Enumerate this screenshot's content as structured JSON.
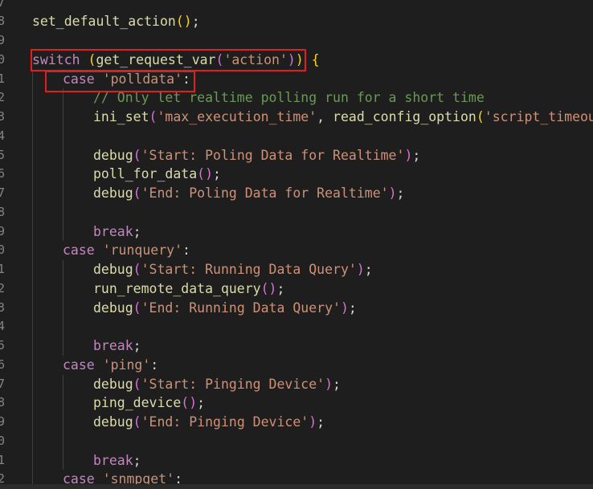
{
  "editor": {
    "lines": [
      {
        "ln": "7",
        "indent": 0,
        "tokens": []
      },
      {
        "ln": "8",
        "indent": 0,
        "tokens": [
          {
            "t": "set_default_action",
            "c": "fn"
          },
          {
            "t": "()",
            "c": "br1"
          },
          {
            "t": ";",
            "c": "plain"
          }
        ]
      },
      {
        "ln": "9",
        "indent": 0,
        "tokens": []
      },
      {
        "ln": "0",
        "indent": 0,
        "tokens": [
          {
            "t": "switch",
            "c": "kw"
          },
          {
            "t": " ",
            "c": "plain"
          },
          {
            "t": "(",
            "c": "br1"
          },
          {
            "t": "get_request_var",
            "c": "fn"
          },
          {
            "t": "(",
            "c": "br2"
          },
          {
            "t": "'action'",
            "c": "str"
          },
          {
            "t": ")",
            "c": "br2"
          },
          {
            "t": ")",
            "c": "br1"
          },
          {
            "t": " ",
            "c": "plain"
          },
          {
            "t": "{",
            "c": "br1"
          }
        ]
      },
      {
        "ln": "1",
        "indent": 1,
        "tokens": [
          {
            "t": "case",
            "c": "kw"
          },
          {
            "t": " ",
            "c": "plain"
          },
          {
            "t": "'polldata'",
            "c": "str"
          },
          {
            "t": ":",
            "c": "plain"
          }
        ]
      },
      {
        "ln": "2",
        "indent": 2,
        "tokens": [
          {
            "t": "// Only let realtime polling run for a short time",
            "c": "com"
          }
        ]
      },
      {
        "ln": "3",
        "indent": 2,
        "tokens": [
          {
            "t": "ini_set",
            "c": "fn"
          },
          {
            "t": "(",
            "c": "br2"
          },
          {
            "t": "'max_execution_time'",
            "c": "str"
          },
          {
            "t": ", ",
            "c": "plain"
          },
          {
            "t": "read_config_option",
            "c": "fn"
          },
          {
            "t": "(",
            "c": "br1"
          },
          {
            "t": "'script_timeout'",
            "c": "str"
          }
        ]
      },
      {
        "ln": "4",
        "indent": 0,
        "tokens": []
      },
      {
        "ln": "5",
        "indent": 2,
        "tokens": [
          {
            "t": "debug",
            "c": "fn"
          },
          {
            "t": "(",
            "c": "br2"
          },
          {
            "t": "'Start: Poling Data for Realtime'",
            "c": "str"
          },
          {
            "t": ")",
            "c": "br2"
          },
          {
            "t": ";",
            "c": "plain"
          }
        ]
      },
      {
        "ln": "6",
        "indent": 2,
        "tokens": [
          {
            "t": "poll_for_data",
            "c": "fn"
          },
          {
            "t": "()",
            "c": "br2"
          },
          {
            "t": ";",
            "c": "plain"
          }
        ]
      },
      {
        "ln": "7",
        "indent": 2,
        "tokens": [
          {
            "t": "debug",
            "c": "fn"
          },
          {
            "t": "(",
            "c": "br2"
          },
          {
            "t": "'End: Poling Data for Realtime'",
            "c": "str"
          },
          {
            "t": ")",
            "c": "br2"
          },
          {
            "t": ";",
            "c": "plain"
          }
        ]
      },
      {
        "ln": "8",
        "indent": 0,
        "tokens": []
      },
      {
        "ln": "9",
        "indent": 2,
        "tokens": [
          {
            "t": "break",
            "c": "kw"
          },
          {
            "t": ";",
            "c": "plain"
          }
        ]
      },
      {
        "ln": "0",
        "indent": 1,
        "tokens": [
          {
            "t": "case",
            "c": "kw"
          },
          {
            "t": " ",
            "c": "plain"
          },
          {
            "t": "'runquery'",
            "c": "str"
          },
          {
            "t": ":",
            "c": "plain"
          }
        ]
      },
      {
        "ln": "1",
        "indent": 2,
        "tokens": [
          {
            "t": "debug",
            "c": "fn"
          },
          {
            "t": "(",
            "c": "br2"
          },
          {
            "t": "'Start: Running Data Query'",
            "c": "str"
          },
          {
            "t": ")",
            "c": "br2"
          },
          {
            "t": ";",
            "c": "plain"
          }
        ]
      },
      {
        "ln": "2",
        "indent": 2,
        "tokens": [
          {
            "t": "run_remote_data_query",
            "c": "fn"
          },
          {
            "t": "()",
            "c": "br2"
          },
          {
            "t": ";",
            "c": "plain"
          }
        ]
      },
      {
        "ln": "3",
        "indent": 2,
        "tokens": [
          {
            "t": "debug",
            "c": "fn"
          },
          {
            "t": "(",
            "c": "br2"
          },
          {
            "t": "'End: Running Data Query'",
            "c": "str"
          },
          {
            "t": ")",
            "c": "br2"
          },
          {
            "t": ";",
            "c": "plain"
          }
        ]
      },
      {
        "ln": "4",
        "indent": 0,
        "tokens": []
      },
      {
        "ln": "5",
        "indent": 2,
        "tokens": [
          {
            "t": "break",
            "c": "kw"
          },
          {
            "t": ";",
            "c": "plain"
          }
        ]
      },
      {
        "ln": "6",
        "indent": 1,
        "tokens": [
          {
            "t": "case",
            "c": "kw"
          },
          {
            "t": " ",
            "c": "plain"
          },
          {
            "t": "'ping'",
            "c": "str"
          },
          {
            "t": ":",
            "c": "plain"
          }
        ]
      },
      {
        "ln": "7",
        "indent": 2,
        "tokens": [
          {
            "t": "debug",
            "c": "fn"
          },
          {
            "t": "(",
            "c": "br2"
          },
          {
            "t": "'Start: Pinging Device'",
            "c": "str"
          },
          {
            "t": ")",
            "c": "br2"
          },
          {
            "t": ";",
            "c": "plain"
          }
        ]
      },
      {
        "ln": "8",
        "indent": 2,
        "tokens": [
          {
            "t": "ping_device",
            "c": "fn"
          },
          {
            "t": "()",
            "c": "br2"
          },
          {
            "t": ";",
            "c": "plain"
          }
        ]
      },
      {
        "ln": "9",
        "indent": 2,
        "tokens": [
          {
            "t": "debug",
            "c": "fn"
          },
          {
            "t": "(",
            "c": "br2"
          },
          {
            "t": "'End: Pinging Device'",
            "c": "str"
          },
          {
            "t": ")",
            "c": "br2"
          },
          {
            "t": ";",
            "c": "plain"
          }
        ]
      },
      {
        "ln": "0",
        "indent": 0,
        "tokens": []
      },
      {
        "ln": "1",
        "indent": 2,
        "tokens": [
          {
            "t": "break",
            "c": "kw"
          },
          {
            "t": ";",
            "c": "plain"
          }
        ]
      },
      {
        "ln": "2",
        "indent": 1,
        "tokens": [
          {
            "t": "case",
            "c": "kw"
          },
          {
            "t": " ",
            "c": "plain"
          },
          {
            "t": "'snmpget'",
            "c": "str"
          },
          {
            "t": ":",
            "c": "plain"
          }
        ]
      }
    ]
  },
  "colors": {
    "background": "#1e1e1e",
    "keyword": "#c586c0",
    "function": "#dcdcaa",
    "string": "#ce9178",
    "comment": "#6a9955",
    "bracket_gold": "#ffd700",
    "bracket_pink": "#da70d6",
    "highlight_box": "#e01e1e"
  }
}
